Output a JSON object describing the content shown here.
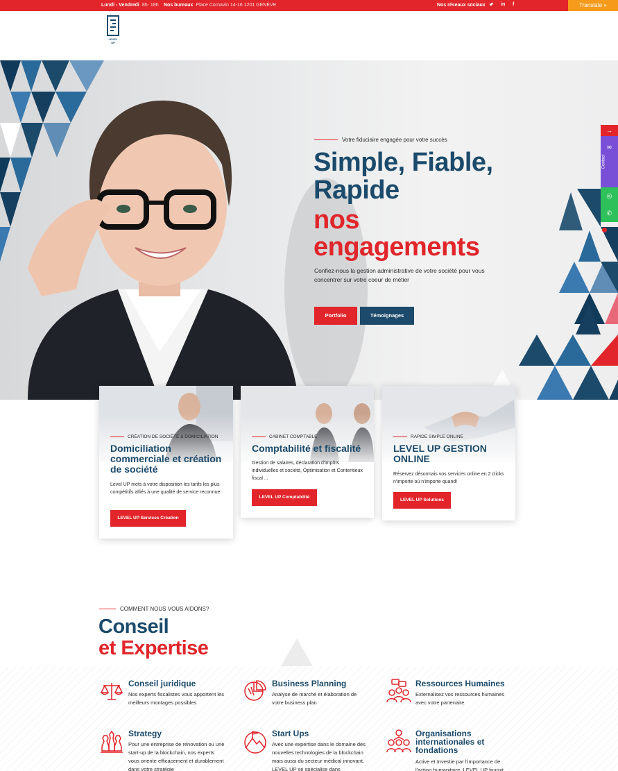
{
  "topbar": {
    "hours_label": "Lundi - Vendredi",
    "hours_value": "8h- 18h",
    "office_label": "Nos bureaux",
    "office_value": "Place Cornavin 14-16 1201 GENÈVE",
    "social_label": "Nos réseaux sociaux",
    "social_icons": [
      "twitter-icon",
      "linkedin-icon",
      "facebook-icon"
    ],
    "translate_label": "Translate »"
  },
  "brand": {
    "logo_text": "LEVEL UP"
  },
  "hero": {
    "eyebrow": "Votre fiduciaire engagée pour votre succès",
    "line1": "Simple, Fiable,",
    "line2": "Rapide",
    "line3": "nos",
    "line4": "engagements",
    "description": "Confiez-nous la gestion administrative de votre société pour vous concentrer sur votre coeur de métier",
    "btn_portfolio": "Portfolio",
    "btn_testimonials": "Témoignages"
  },
  "side_widget": {
    "contact_label": "Contact"
  },
  "cards": [
    {
      "tag": "CRÉATION DE SOCIÉTÉ & DOMICILIATION",
      "title": "Domiciliation commerciale et création de société",
      "text": "Level UP mets à votre disposition les tarifs les plus compétitifs alliés à une qualité de service reconnue",
      "button": "LEVEL UP Services Création"
    },
    {
      "tag": "CABINET COMPTABLE",
      "title": "Comptabilité et fiscalité",
      "text": "Gestion de salaires, déclaration d'impôts individuelles et société, Optimisation et Contentieux fiscal ...",
      "button": "LEVEL UP Comptabilité"
    },
    {
      "tag": "RAPIDE SIMPLE ONLINE",
      "title": "LEVEL UP GESTION ONLINE",
      "text": "Réservez désormais vos services online en 2 clicks n'importe où n'importe quand!",
      "button": "LEVEL UP Solutions"
    }
  ],
  "section": {
    "eyebrow": "COMMENT NOUS VOUS AIDONS?",
    "title1": "Conseil",
    "title2": "et Expertise"
  },
  "features": [
    {
      "icon": "scales-icon",
      "title": "Conseil juridique",
      "text": "Nos experts fiscalistes vous apportent les meilleurs montages possibles"
    },
    {
      "icon": "pie-chart-icon",
      "title": "Business Planning",
      "text": "Analyse de marché et élaboration de votre business plan"
    },
    {
      "icon": "team-chat-icon",
      "title": "Ressources Humaines",
      "text": "Externalisez vos ressources humaines avec votre partenaire"
    },
    {
      "icon": "chess-icon",
      "title": "Strategy",
      "text": "Pour une entreprise de rénovation ou une start-up de la blockchain, nos experts vous oriente efficacement et durablement dans votre stratégie"
    },
    {
      "icon": "mountain-flag-icon",
      "title": "Start Ups",
      "text": "Avec une expertise dans le domaine des nouvelles technologies de la blockchain mais aussi du secteur médical innovant, LEVEL UP se spécialise dans"
    },
    {
      "icon": "organization-icon",
      "title": "Organisations internationales et fondations",
      "text": "Active et Investie par l'importance de l'action humanitaire, LEVEL UP fournit"
    }
  ],
  "colors": {
    "navy": "#1b4a6b",
    "red": "#e1252a",
    "orange": "#f59a1b",
    "purple": "#7a4fd8",
    "green": "#2ec05a"
  }
}
